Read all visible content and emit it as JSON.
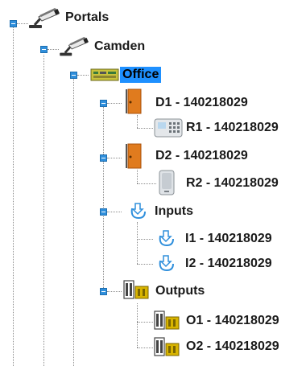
{
  "tree": {
    "root": {
      "label": "Portals",
      "icon": "camera-icon",
      "children": [
        {
          "label": "Camden",
          "icon": "camera-icon",
          "children": [
            {
              "label": "Office",
              "icon": "controller-board-icon",
              "selected": true,
              "children": [
                {
                  "label": "D1 - 140218029",
                  "icon": "door-icon",
                  "children": [
                    {
                      "label": "R1 - 140218029",
                      "icon": "keypad-reader-icon"
                    }
                  ]
                },
                {
                  "label": "D2 - 140218029",
                  "icon": "door-icon",
                  "children": [
                    {
                      "label": "R2 - 140218029",
                      "icon": "card-reader-icon"
                    }
                  ]
                },
                {
                  "label": "Inputs",
                  "icon": "input-arrow-icon",
                  "children": [
                    {
                      "label": "I1 - 140218029",
                      "icon": "input-arrow-icon"
                    },
                    {
                      "label": "I2 - 140218029",
                      "icon": "input-arrow-icon"
                    }
                  ]
                },
                {
                  "label": "Outputs",
                  "icon": "output-relay-icon",
                  "children": [
                    {
                      "label": "O1 - 140218029",
                      "icon": "output-relay-icon"
                    },
                    {
                      "label": "O2 - 140218029",
                      "icon": "output-relay-icon"
                    }
                  ]
                }
              ]
            }
          ]
        }
      ]
    }
  },
  "colors": {
    "selection": "#1e90ff",
    "toggle": "#2f8fdc",
    "door": "#e07b1e",
    "relay": "#d8b400"
  }
}
